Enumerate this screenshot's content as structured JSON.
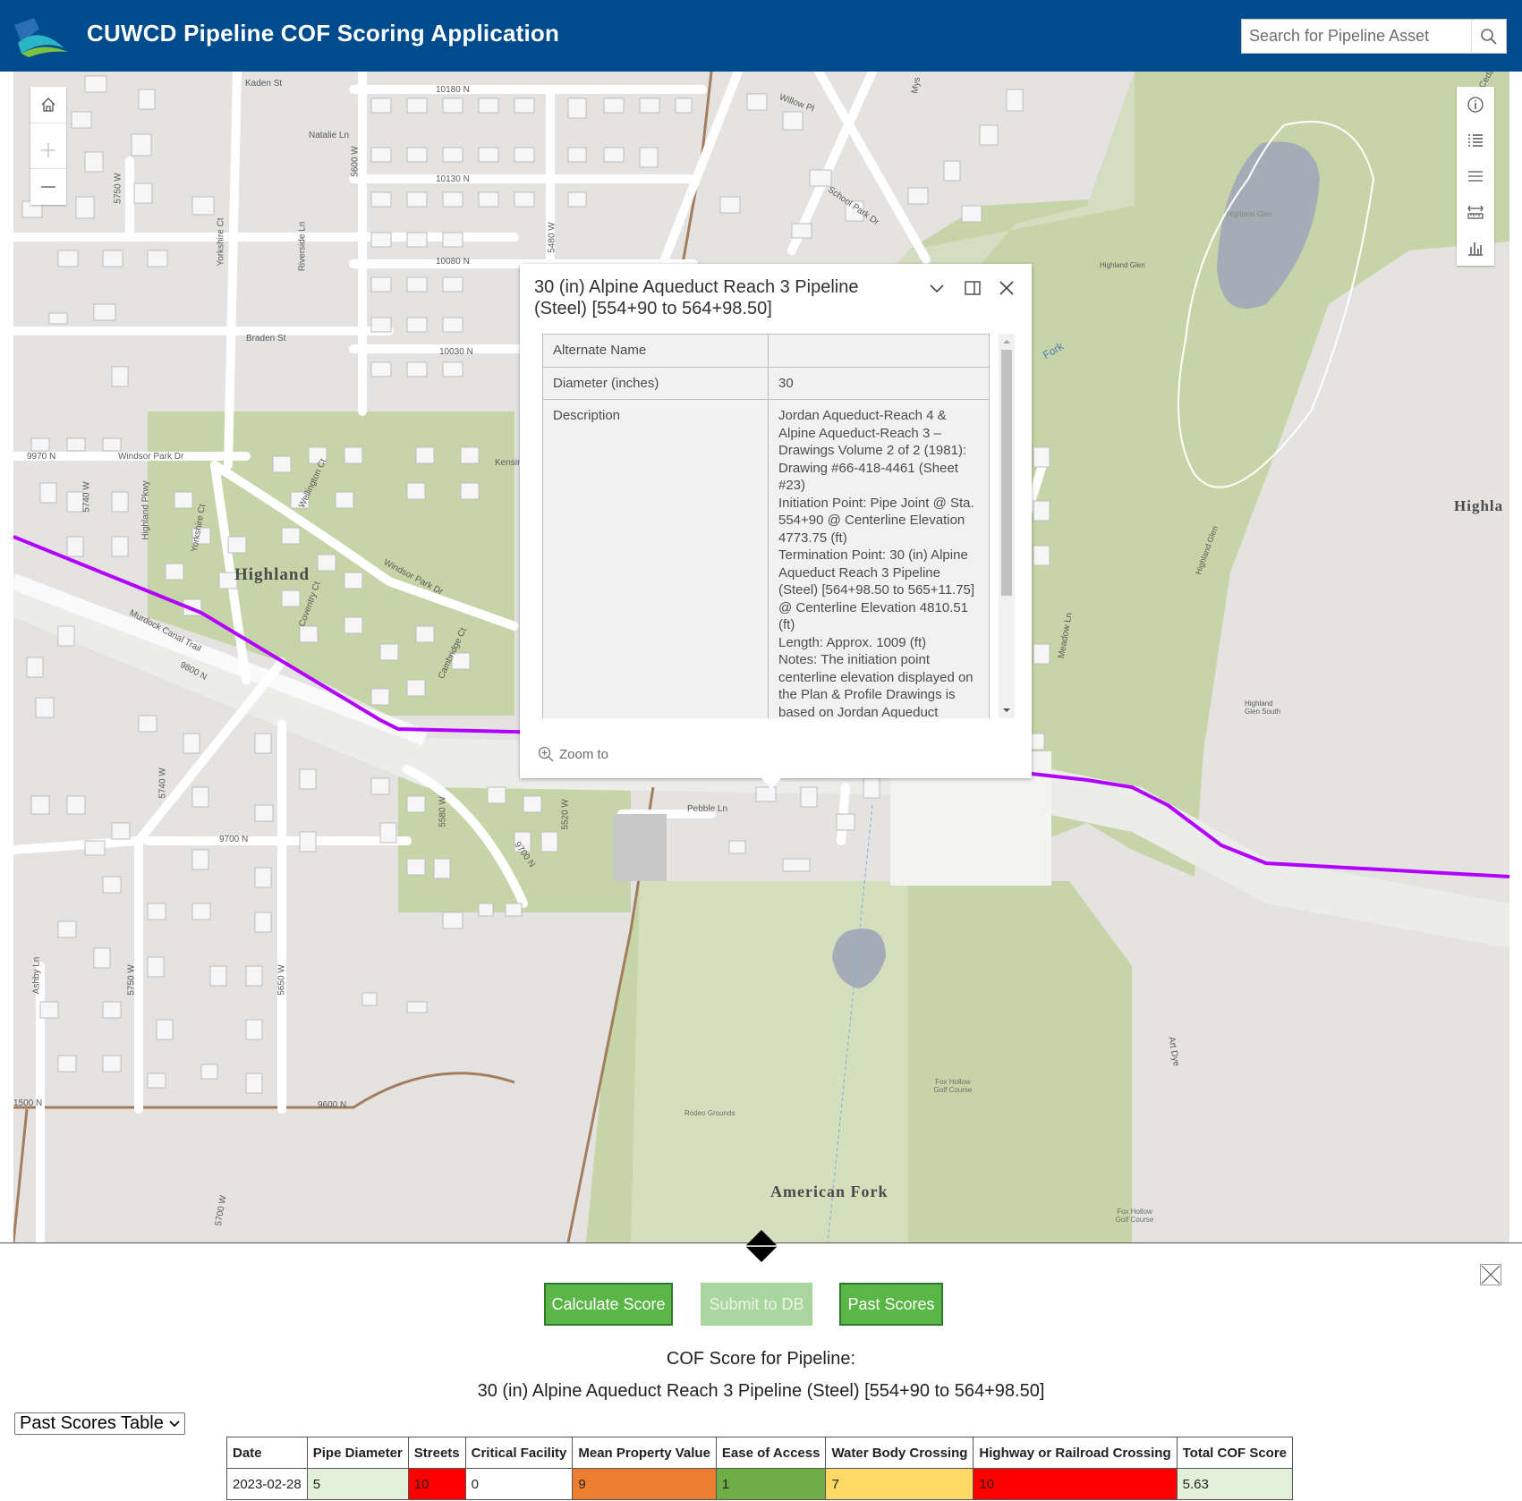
{
  "header": {
    "title": "CUWCD Pipeline COF Scoring Application",
    "search_placeholder": "Search for Pipeline Asset"
  },
  "map": {
    "street_labels": {
      "kaden": "Kaden St",
      "r10180": "10180 N",
      "natalie": "Natalie Ln",
      "w5600": "5600 W",
      "r10130": "10130 N",
      "w5750a": "5750 W",
      "yorkshire1": "Yorkshire Ct",
      "riverside": "Riverside Ln",
      "w5480": "5480 W",
      "r10080": "10080 N",
      "braden": "Braden St",
      "r10030": "10030 N",
      "r9970": "9970 N",
      "windsor1": "Windsor Park Dr",
      "w5740a": "5740 W",
      "hpkwy": "Highland Pkwy",
      "yorkshire2": "Yorkshire Ct",
      "wellington": "Wellington Ct",
      "kensin": "Kensin",
      "windsor2": "Windsor Park Dr",
      "coventry": "Coventry Ct",
      "cambridge": "Cambridge Ct",
      "murdock": "Murdock Canal Trail",
      "r9800": "9800 N",
      "willow": "Willow Pl",
      "school": "School Park Dr",
      "mys": "Mys",
      "hglen1": "Highland Glen",
      "hglen2": "Highland Glen",
      "hglen3": "Highland Glen",
      "hglensouth": "Highland Glen South",
      "fork": "Fork",
      "meadow": "Meadow Ln",
      "pebble": "Pebble Ln",
      "w5740b": "5740 W",
      "r9700": "9700 N",
      "w5580": "5580 W",
      "w5520": "5520 W",
      "r9700b": "9700 N",
      "ashby": "Ashby Ln",
      "w5750b": "5750 W",
      "w5650": "5650 W",
      "r9600": "9600 N",
      "r1500": "1500 N",
      "w5700": "5700 W",
      "artdye": "Art Dye",
      "rodeo": "Rodeo Grounds",
      "foxhollow1": "Fox Hollow Golf Course",
      "foxhollow2": "Fox Hollow Golf Course",
      "ceda": "Ceda"
    },
    "place_labels": {
      "highland": "Highland",
      "highland_right": "Highla",
      "american_fork": "American Fork"
    },
    "pipeline_color": "#b200ff",
    "selected_color": "#5bd2ff"
  },
  "popup": {
    "title": "30 (in) Alpine Aqueduct Reach 3 Pipeline (Steel) [554+90 to 564+98.50]",
    "rows": [
      {
        "key": "Alternate Name",
        "value": ""
      },
      {
        "key": "Diameter (inches)",
        "value": "30"
      },
      {
        "key": "Description",
        "value": "Jordan Aqueduct-Reach 4 & Alpine Aqueduct-Reach 3 – Drawings Volume 2 of 2 (1981): Drawing #66-418-4461 (Sheet #23)\nInitiation Point: Pipe Joint @ Sta. 554+90 @ Centerline Elevation 4773.75 (ft)\nTermination Point: 30 (in) Alpine Aqueduct Reach 3 Pipeline (Steel) [564+98.50 to 565+11.75] @ Centerline Elevation 4810.51 (ft)\nLength: Approx. 1009 (ft)\nNotes: The initiation point centerline elevation displayed on the Plan & Profile Drawings is based on Jordan Aqueduct"
      }
    ],
    "zoom_to": "Zoom to"
  },
  "panel": {
    "buttons": {
      "calculate": "Calculate Score",
      "submit": "Submit to DB",
      "past": "Past Scores"
    },
    "cof_heading": "COF Score for Pipeline:",
    "pipeline_name": "30 (in) Alpine Aqueduct Reach 3 Pipeline (Steel) [554+90 to 564+98.50]",
    "view_select": "Past Scores Table",
    "table": {
      "headers": [
        "Date",
        "Pipe Diameter",
        "Streets",
        "Critical Facility",
        "Mean Property Value",
        "Ease of Access",
        "Water Body Crossing",
        "Highway or Railroad Crossing",
        "Total COF Score"
      ],
      "rows": [
        [
          {
            "text": "2023-02-28",
            "color": "#ffffff"
          },
          {
            "text": "5",
            "color": "#e2f0d9"
          },
          {
            "text": "10",
            "color": "#ff0000"
          },
          {
            "text": "0",
            "color": "#ffffff"
          },
          {
            "text": "9",
            "color": "#ed7d31"
          },
          {
            "text": "1",
            "color": "#70ad47"
          },
          {
            "text": "7",
            "color": "#ffd966"
          },
          {
            "text": "10",
            "color": "#ff0000"
          },
          {
            "text": "5.63",
            "color": "#e2f0d9"
          }
        ]
      ]
    }
  }
}
